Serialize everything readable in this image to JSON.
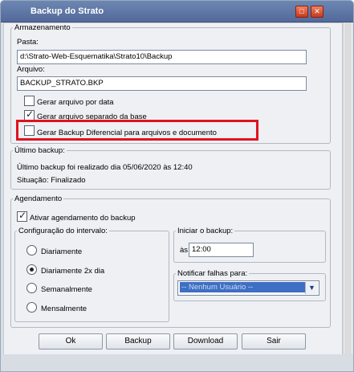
{
  "window": {
    "title": "Backup do Strato",
    "maximize_icon": "maximize-icon",
    "close_icon": "close-icon"
  },
  "armazenamento": {
    "legend": "Armazenamento",
    "pasta_label": "Pasta:",
    "pasta_value": "d:\\Strato-Web-Esquematika\\Strato10\\Backup",
    "arquivo_label": "Arquivo:",
    "arquivo_value": "BACKUP_STRATO.BKP",
    "checkboxes": [
      {
        "label": "Gerar arquivo por data",
        "checked": false
      },
      {
        "label": "Gerar arquivo separado da base",
        "checked": true
      },
      {
        "label": "Gerar Backup Diferencial para arquivos e documento",
        "checked": false
      }
    ]
  },
  "ultimo_backup": {
    "legend": "Último backup:",
    "info": "Último backup foi realizado dia 05/06/2020 às 12:40",
    "situacao": "Situação: Finalizado"
  },
  "agendamento": {
    "legend": "Agendamento",
    "ativar_label": "Ativar agendamento do backup",
    "ativar_checked": true,
    "intervalo": {
      "legend": "Configuração do intervalo:",
      "options": [
        {
          "label": "Diariamente",
          "selected": false
        },
        {
          "label": "Diariamente 2x dia",
          "selected": true
        },
        {
          "label": "Semanalmente",
          "selected": false
        },
        {
          "label": "Mensalmente",
          "selected": false
        }
      ]
    },
    "iniciar": {
      "legend": "Iniciar o backup:",
      "prefix": "às",
      "time": "12:00"
    },
    "notificar": {
      "legend": "Notificar falhas para:",
      "selected": "-- Nenhum Usuário --"
    }
  },
  "buttons": {
    "ok": "Ok",
    "backup": "Backup",
    "download": "Download",
    "sair": "Sair"
  },
  "colors": {
    "highlight": "#e0141e",
    "titlebar": "#5f78a8",
    "selection": "#3e6fc4"
  }
}
